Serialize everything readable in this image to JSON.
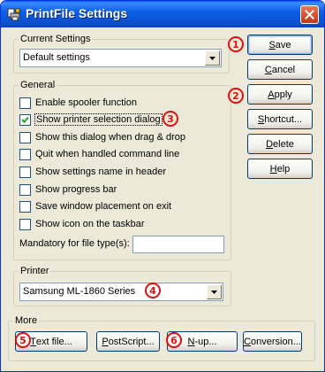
{
  "window": {
    "title": "PrintFile Settings"
  },
  "current_settings": {
    "legend": "Current Settings",
    "selected": "Default settings"
  },
  "general": {
    "legend": "General",
    "options": [
      {
        "label": "Enable spooler function",
        "checked": false
      },
      {
        "label": "Show printer selection dialog",
        "checked": true
      },
      {
        "label": "Show this dialog when drag & drop",
        "checked": false
      },
      {
        "label": "Quit when handled command line",
        "checked": false
      },
      {
        "label": "Show settings name in header",
        "checked": false
      },
      {
        "label": "Show progress bar",
        "checked": false
      },
      {
        "label": "Save window placement on exit",
        "checked": false
      },
      {
        "label": "Show icon on the taskbar",
        "checked": false
      }
    ],
    "mandatory_label": "Mandatory for file type(s):",
    "mandatory_value": ""
  },
  "printer": {
    "legend": "Printer",
    "selected": "Samsung ML-1860 Series"
  },
  "more": {
    "legend": "More",
    "text_file_mn": "T",
    "text_file_rest": "ext file...",
    "postscript_mn": "P",
    "postscript_rest": "ostScript...",
    "nup_mn": "N",
    "nup_rest": "-up...",
    "conversion_mn": "C",
    "conversion_rest": "onversion..."
  },
  "side_buttons": {
    "save_mn": "S",
    "save_rest": "ave",
    "cancel_mn": "C",
    "cancel_rest": "ancel",
    "apply_mn": "A",
    "apply_rest": "pply",
    "shortcut_mn": "S",
    "shortcut_rest": "hortcut...",
    "delete_mn": "D",
    "delete_rest": "elete",
    "help_mn": "H",
    "help_rest": "elp"
  },
  "callouts": [
    "1",
    "2",
    "3",
    "4",
    "5",
    "6"
  ],
  "colors": {
    "titlebar": "#0a5df0",
    "callout": "#e01010",
    "dialog": "#ece9d8"
  },
  "icons": {
    "app": "printfile-app-icon",
    "close": "close-icon",
    "dropdown": "chevron-down-icon",
    "check": "check-icon"
  }
}
